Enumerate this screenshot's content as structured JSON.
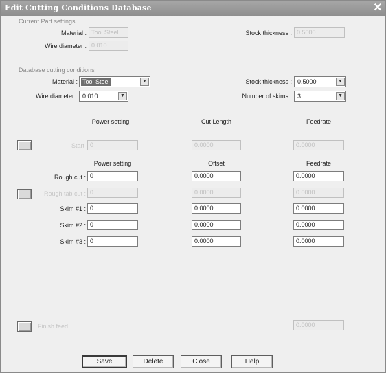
{
  "window": {
    "title": "Edit Cutting Conditions Database",
    "close_glyph": "✕"
  },
  "current": {
    "section": "Current Part settings",
    "material_label": "Material :",
    "material_value": "Tool Steel",
    "wire_label": "Wire diameter :",
    "wire_value": "0.010",
    "stock_label": "Stock thickness :",
    "stock_value": "0.5000"
  },
  "database": {
    "section": "Database cutting conditions",
    "material_label": "Material :",
    "material_value": "Tool Steel",
    "wire_label": "Wire diameter :",
    "wire_value": "0.010",
    "stock_label": "Stock thickness :",
    "stock_value": "0.5000",
    "skims_label": "Number of skims :",
    "skims_value": "3"
  },
  "start": {
    "hdr_power": "Power setting",
    "hdr_cut_length": "Cut Length",
    "hdr_feedrate": "Feedrate",
    "label": "Start",
    "power": "0",
    "cut_length": "0.0000",
    "feedrate": "0.0000"
  },
  "passes": {
    "hdr_power": "Power setting",
    "hdr_offset": "Offset",
    "hdr_feedrate": "Feedrate",
    "rows": [
      {
        "label": "Rough cut :",
        "power": "0",
        "offset": "0.0000",
        "feedrate": "0.0000"
      },
      {
        "label": "Rough tab cut :",
        "power": "0",
        "offset": "0.0000",
        "feedrate": "0.0000"
      },
      {
        "label": "Skim #1 :",
        "power": "0",
        "offset": "0.0000",
        "feedrate": "0.0000"
      },
      {
        "label": "Skim #2 :",
        "power": "0",
        "offset": "0.0000",
        "feedrate": "0.0000"
      },
      {
        "label": "Skim #3 :",
        "power": "0",
        "offset": "0.0000",
        "feedrate": "0.0000"
      }
    ]
  },
  "finish": {
    "label": "Finish feed",
    "feedrate": "0.0000"
  },
  "buttons": {
    "save": "Save",
    "delete": "Delete",
    "close": "Close",
    "help": "Help"
  }
}
